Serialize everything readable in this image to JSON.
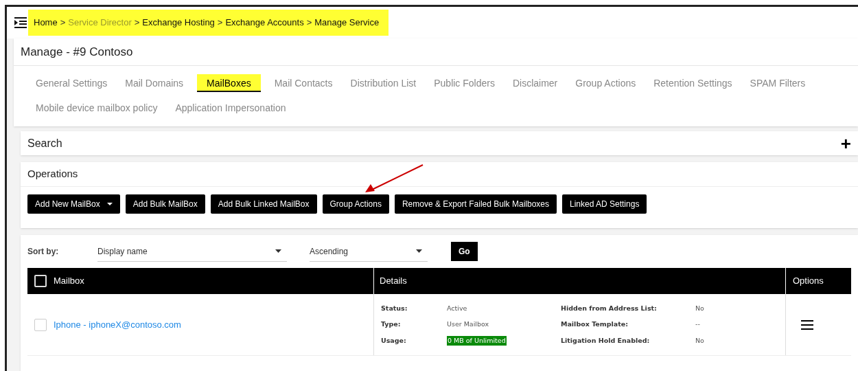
{
  "breadcrumb": {
    "separator": ">",
    "items": [
      {
        "label": "Home",
        "muted": false
      },
      {
        "label": "Service Director",
        "muted": true
      },
      {
        "label": "Exchange Hosting",
        "muted": false
      },
      {
        "label": "Exchange Accounts",
        "muted": false
      },
      {
        "label": "Manage Service",
        "muted": false
      }
    ]
  },
  "page_title": "Manage - #9 Contoso",
  "tabs": [
    {
      "label": "General Settings",
      "selected": false
    },
    {
      "label": "Mail Domains",
      "selected": false
    },
    {
      "label": "MailBoxes",
      "selected": true
    },
    {
      "label": "Mail Contacts",
      "selected": false
    },
    {
      "label": "Distribution List",
      "selected": false
    },
    {
      "label": "Public Folders",
      "selected": false
    },
    {
      "label": "Disclaimer",
      "selected": false
    },
    {
      "label": "Group Actions",
      "selected": false
    },
    {
      "label": "Retention Settings",
      "selected": false
    },
    {
      "label": "SPAM Filters",
      "selected": false
    },
    {
      "label": "Mobile device mailbox policy",
      "selected": false
    },
    {
      "label": "Application Impersonation",
      "selected": false
    }
  ],
  "search": {
    "title": "Search",
    "expand_icon": "+"
  },
  "operations": {
    "title": "Operations",
    "buttons": [
      {
        "label": "Add New MailBox",
        "dropdown": true
      },
      {
        "label": "Add Bulk MailBox",
        "dropdown": false
      },
      {
        "label": "Add Bulk Linked MailBox",
        "dropdown": false
      },
      {
        "label": "Group Actions",
        "dropdown": false
      },
      {
        "label": "Remove & Export Failed Bulk Mailboxes",
        "dropdown": false
      },
      {
        "label": "Linked AD Settings",
        "dropdown": false
      }
    ]
  },
  "sort": {
    "label": "Sort by:",
    "field": "Display name",
    "order": "Ascending",
    "button": "Go"
  },
  "table": {
    "columns": [
      "Mailbox",
      "Details",
      "Options"
    ],
    "select_all_checked": false,
    "rows": [
      {
        "checked": false,
        "mailbox": "Iphone - iphoneX@contoso.com",
        "details_left": [
          {
            "label": "Status:",
            "value": "Active",
            "kind": "plain"
          },
          {
            "label": "Type:",
            "value": "User Mailbox",
            "kind": "plain"
          },
          {
            "label": "Usage:",
            "value": "0 MB of Unlimited",
            "kind": "usage"
          }
        ],
        "details_right": [
          {
            "label": "Hidden from Address List:",
            "value": "No"
          },
          {
            "label": "Mailbox Template:",
            "value": "--"
          },
          {
            "label": "Litigation Hold Enabled:",
            "value": "No"
          }
        ]
      }
    ]
  }
}
